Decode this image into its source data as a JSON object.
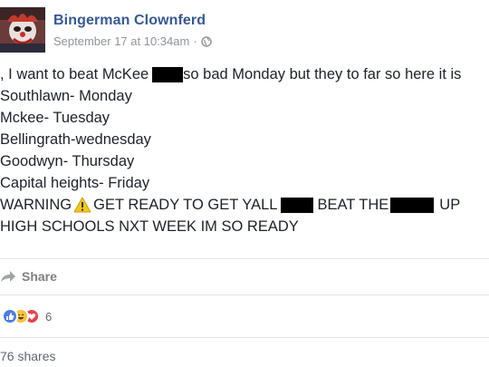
{
  "post": {
    "author": "Bingerman Clownferd",
    "timestamp": "September 17 at 10:34am",
    "separator": "·",
    "privacy_icon": "globe-icon",
    "lines": {
      "l1a": ", I want to beat McKee",
      "l1b": "so bad Monday but they to far so here it is",
      "l2": "Southlawn- Monday",
      "l3": "Mckee- Tuesday",
      "l4": "Bellingrath-wednesday",
      "l5": "Goodwyn- Thursday",
      "l6": "Capital heights- Friday",
      "l7a": "WARNING",
      "l7b": "GET READY TO GET YALL",
      "l7c": "BEAT THE",
      "l7d": "UP",
      "l8": "HIGH SCHOOLS NXT WEEK IM SO READY"
    }
  },
  "actions": {
    "share_label": "Share",
    "share_icon": "share-arrow-icon"
  },
  "reactions": {
    "icons": [
      "like-icon",
      "haha-icon",
      "love-icon"
    ],
    "count": "6"
  },
  "shares": {
    "label": "76 shares"
  },
  "colors": {
    "author": "#365899",
    "meta": "#90949c",
    "text": "#1d2129",
    "like": "#4a7ee8",
    "haha": "#f7c33c",
    "love": "#e9414f"
  }
}
